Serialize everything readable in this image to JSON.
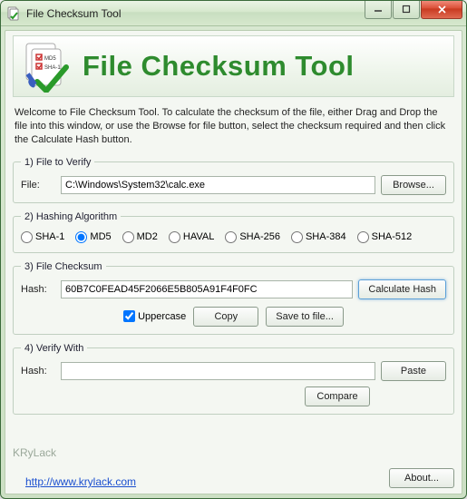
{
  "window": {
    "title": "File Checksum Tool"
  },
  "banner": {
    "md5_label": "MD5",
    "sha1_label": "SHA-1",
    "title": "File Checksum Tool"
  },
  "welcome": "Welcome to File Checksum Tool. To calculate the checksum of the file, either Drag and Drop the file into this window, or use the Browse for file button, select the checksum required and then click the Calculate Hash button.",
  "groups": {
    "file": {
      "legend": "1) File to Verify",
      "label": "File:",
      "value": "C:\\Windows\\System32\\calc.exe",
      "browse": "Browse..."
    },
    "algo": {
      "legend": "2) Hashing Algorithm",
      "options": [
        "SHA-1",
        "MD5",
        "MD2",
        "HAVAL",
        "SHA-256",
        "SHA-384",
        "SHA-512"
      ],
      "selected": "MD5"
    },
    "checksum": {
      "legend": "3) File Checksum",
      "label": "Hash:",
      "value": "60B7C0FEAD45F2066E5B805A91F4F0FC",
      "calculate": "Calculate Hash",
      "uppercase_label": "Uppercase",
      "uppercase_checked": true,
      "copy": "Copy",
      "save": "Save to file..."
    },
    "verify": {
      "legend": "4) Verify With",
      "label": "Hash:",
      "value": "",
      "paste": "Paste",
      "compare": "Compare"
    }
  },
  "footer": {
    "brand": "KRyLack",
    "url": "http://www.krylack.com",
    "about": "About..."
  }
}
